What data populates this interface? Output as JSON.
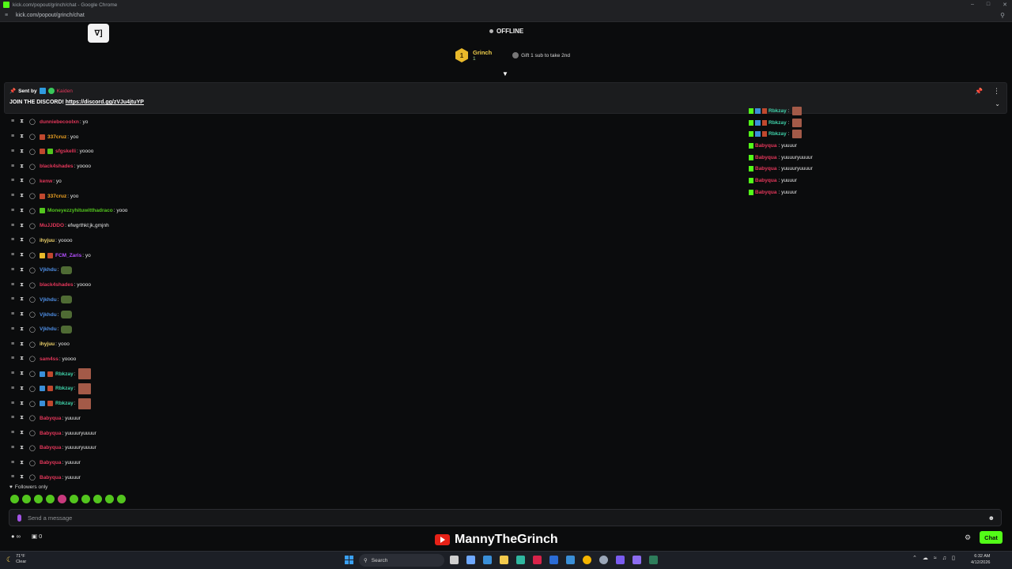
{
  "browser": {
    "window_title": "kick.com/popout/grinch/chat - Google Chrome",
    "url": "kick.com/popout/grinch/chat"
  },
  "stream": {
    "logo_text": "∇]",
    "status": "OFFLINE",
    "gifter": {
      "rank": "1",
      "name": "Grinch",
      "count": "1"
    },
    "gift_prompt": "Gift 1 sub to take 2nd"
  },
  "pinned": {
    "sent_by_label": "Sent by",
    "sender": "Kaiden",
    "text": "JOIN THE DISCORD!",
    "link": "https://discord.gg/zVJu4jtuYP"
  },
  "messages": [
    {
      "user": "dunniebecoolxn",
      "color": "#e3375a",
      "text": ": yo",
      "badges": []
    },
    {
      "user": "337cruz",
      "color": "#f5a623",
      "text": ": yoo",
      "badges": [
        "#c0482e"
      ]
    },
    {
      "user": "sfgskelli",
      "color": "#e3375a",
      "text": ": yoooo",
      "badges": [
        "#c0482e",
        "#53c51e"
      ]
    },
    {
      "user": "black4shades",
      "color": "#e3375a",
      "text": ": yoooo",
      "badges": []
    },
    {
      "user": "kenw",
      "color": "#e3375a",
      "text": ": yo",
      "badges": []
    },
    {
      "user": "337cruz",
      "color": "#f5a623",
      "text": ": yoo",
      "badges": [
        "#c0482e"
      ]
    },
    {
      "user": "Moneyezzyhituwitthadraco",
      "color": "#53c51e",
      "text": ": yooo",
      "badges": [
        "#53c51e"
      ]
    },
    {
      "user": "MuJJDDO",
      "color": "#e3375a",
      "text": ": efwgrthkl;jk,gmjnh",
      "badges": []
    },
    {
      "user": "ihyjuu",
      "color": "#f0d46b",
      "text": ": yoooo",
      "badges": []
    },
    {
      "user": "FCM_Zaris",
      "color": "#b44fff",
      "text": ": yo",
      "badges": [
        "#e9b92b",
        "#c0482e"
      ]
    },
    {
      "user": "Vjkhdu",
      "color": "#4f8fe6",
      "text": ":",
      "badges": [],
      "emote": "frog"
    },
    {
      "user": "black4shades",
      "color": "#e3375a",
      "text": ": yoooo",
      "badges": []
    },
    {
      "user": "Vjkhdu",
      "color": "#4f8fe6",
      "text": ":",
      "badges": [],
      "emote": "frog"
    },
    {
      "user": "Vjkhdu",
      "color": "#4f8fe6",
      "text": ":",
      "badges": [],
      "emote": "frog"
    },
    {
      "user": "Vjkhdu",
      "color": "#4f8fe6",
      "text": ":",
      "badges": [],
      "emote": "frog"
    },
    {
      "user": "ihyjuu",
      "color": "#f0d46b",
      "text": ": yooo",
      "badges": []
    },
    {
      "user": "sam4ss",
      "color": "#e3375a",
      "text": ": yoooo",
      "badges": []
    },
    {
      "user": "Rbkzay",
      "color": "#3fd0a8",
      "text": ":",
      "badges": [
        "#3a8fd8",
        "#c0482e"
      ],
      "emote": "photo"
    },
    {
      "user": "Rbkzay",
      "color": "#3fd0a8",
      "text": ":",
      "badges": [
        "#3a8fd8",
        "#c0482e"
      ],
      "emote": "photo"
    },
    {
      "user": "Rbkzay",
      "color": "#3fd0a8",
      "text": ":",
      "badges": [
        "#3a8fd8",
        "#c0482e"
      ],
      "emote": "photo"
    },
    {
      "user": "Babyqua",
      "color": "#e3375a",
      "text": ": yuuuur",
      "badges": []
    },
    {
      "user": "Babyqua",
      "color": "#e3375a",
      "text": ": yuuuuryuuuur",
      "badges": []
    },
    {
      "user": "Babyqua",
      "color": "#e3375a",
      "text": ": yuuuuryuuuur",
      "badges": []
    },
    {
      "user": "Babyqua",
      "color": "#e3375a",
      "text": ": yuuuur",
      "badges": []
    },
    {
      "user": "Babyqua",
      "color": "#e3375a",
      "text": ": yuuuur",
      "badges": []
    }
  ],
  "overlay": [
    {
      "user": "Rbkzay",
      "color": "#3fd0a8",
      "text": ":",
      "emote": true,
      "blue": true
    },
    {
      "user": "Rbkzay",
      "color": "#3fd0a8",
      "text": ":",
      "emote": true,
      "blue": true
    },
    {
      "user": "Rbkzay",
      "color": "#3fd0a8",
      "text": ":",
      "emote": true,
      "blue": true
    },
    {
      "user": "Babyqua",
      "color": "#e3375a",
      "text": ": yuuuur",
      "emote": false,
      "blue": false
    },
    {
      "user": "Babyqua",
      "color": "#e3375a",
      "text": ": yuuuuryuuuur",
      "emote": false,
      "blue": false
    },
    {
      "user": "Babyqua",
      "color": "#e3375a",
      "text": ": yuuuuryuuuur",
      "emote": false,
      "blue": false
    },
    {
      "user": "Babyqua",
      "color": "#e3375a",
      "text": ": yuuuur",
      "emote": false,
      "blue": false
    },
    {
      "user": "Babyqua",
      "color": "#e3375a",
      "text": ": yuuuur",
      "emote": false,
      "blue": false
    }
  ],
  "footer": {
    "followers_only": "Followers only",
    "input_placeholder": "Send a message",
    "infinity": "∞",
    "count": "0",
    "channel_watermark": "MannyTheGrinch",
    "chat_button": "Chat"
  },
  "taskbar": {
    "weather_temp": "71°F",
    "weather_desc": "Clear",
    "search_label": "Search",
    "time": "6:32 AM",
    "date": "4/12/2026"
  },
  "colors": {
    "kick_green": "#53fc18",
    "bg": "#0b0c0d"
  }
}
